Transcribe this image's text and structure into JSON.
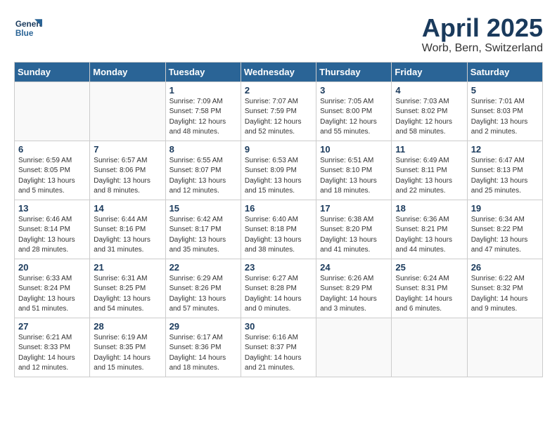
{
  "header": {
    "logo_line1": "General",
    "logo_line2": "Blue",
    "month": "April 2025",
    "location": "Worb, Bern, Switzerland"
  },
  "weekdays": [
    "Sunday",
    "Monday",
    "Tuesday",
    "Wednesday",
    "Thursday",
    "Friday",
    "Saturday"
  ],
  "weeks": [
    [
      {
        "day": "",
        "info": ""
      },
      {
        "day": "",
        "info": ""
      },
      {
        "day": "1",
        "info": "Sunrise: 7:09 AM\nSunset: 7:58 PM\nDaylight: 12 hours\nand 48 minutes."
      },
      {
        "day": "2",
        "info": "Sunrise: 7:07 AM\nSunset: 7:59 PM\nDaylight: 12 hours\nand 52 minutes."
      },
      {
        "day": "3",
        "info": "Sunrise: 7:05 AM\nSunset: 8:00 PM\nDaylight: 12 hours\nand 55 minutes."
      },
      {
        "day": "4",
        "info": "Sunrise: 7:03 AM\nSunset: 8:02 PM\nDaylight: 12 hours\nand 58 minutes."
      },
      {
        "day": "5",
        "info": "Sunrise: 7:01 AM\nSunset: 8:03 PM\nDaylight: 13 hours\nand 2 minutes."
      }
    ],
    [
      {
        "day": "6",
        "info": "Sunrise: 6:59 AM\nSunset: 8:05 PM\nDaylight: 13 hours\nand 5 minutes."
      },
      {
        "day": "7",
        "info": "Sunrise: 6:57 AM\nSunset: 8:06 PM\nDaylight: 13 hours\nand 8 minutes."
      },
      {
        "day": "8",
        "info": "Sunrise: 6:55 AM\nSunset: 8:07 PM\nDaylight: 13 hours\nand 12 minutes."
      },
      {
        "day": "9",
        "info": "Sunrise: 6:53 AM\nSunset: 8:09 PM\nDaylight: 13 hours\nand 15 minutes."
      },
      {
        "day": "10",
        "info": "Sunrise: 6:51 AM\nSunset: 8:10 PM\nDaylight: 13 hours\nand 18 minutes."
      },
      {
        "day": "11",
        "info": "Sunrise: 6:49 AM\nSunset: 8:11 PM\nDaylight: 13 hours\nand 22 minutes."
      },
      {
        "day": "12",
        "info": "Sunrise: 6:47 AM\nSunset: 8:13 PM\nDaylight: 13 hours\nand 25 minutes."
      }
    ],
    [
      {
        "day": "13",
        "info": "Sunrise: 6:46 AM\nSunset: 8:14 PM\nDaylight: 13 hours\nand 28 minutes."
      },
      {
        "day": "14",
        "info": "Sunrise: 6:44 AM\nSunset: 8:16 PM\nDaylight: 13 hours\nand 31 minutes."
      },
      {
        "day": "15",
        "info": "Sunrise: 6:42 AM\nSunset: 8:17 PM\nDaylight: 13 hours\nand 35 minutes."
      },
      {
        "day": "16",
        "info": "Sunrise: 6:40 AM\nSunset: 8:18 PM\nDaylight: 13 hours\nand 38 minutes."
      },
      {
        "day": "17",
        "info": "Sunrise: 6:38 AM\nSunset: 8:20 PM\nDaylight: 13 hours\nand 41 minutes."
      },
      {
        "day": "18",
        "info": "Sunrise: 6:36 AM\nSunset: 8:21 PM\nDaylight: 13 hours\nand 44 minutes."
      },
      {
        "day": "19",
        "info": "Sunrise: 6:34 AM\nSunset: 8:22 PM\nDaylight: 13 hours\nand 47 minutes."
      }
    ],
    [
      {
        "day": "20",
        "info": "Sunrise: 6:33 AM\nSunset: 8:24 PM\nDaylight: 13 hours\nand 51 minutes."
      },
      {
        "day": "21",
        "info": "Sunrise: 6:31 AM\nSunset: 8:25 PM\nDaylight: 13 hours\nand 54 minutes."
      },
      {
        "day": "22",
        "info": "Sunrise: 6:29 AM\nSunset: 8:26 PM\nDaylight: 13 hours\nand 57 minutes."
      },
      {
        "day": "23",
        "info": "Sunrise: 6:27 AM\nSunset: 8:28 PM\nDaylight: 14 hours\nand 0 minutes."
      },
      {
        "day": "24",
        "info": "Sunrise: 6:26 AM\nSunset: 8:29 PM\nDaylight: 14 hours\nand 3 minutes."
      },
      {
        "day": "25",
        "info": "Sunrise: 6:24 AM\nSunset: 8:31 PM\nDaylight: 14 hours\nand 6 minutes."
      },
      {
        "day": "26",
        "info": "Sunrise: 6:22 AM\nSunset: 8:32 PM\nDaylight: 14 hours\nand 9 minutes."
      }
    ],
    [
      {
        "day": "27",
        "info": "Sunrise: 6:21 AM\nSunset: 8:33 PM\nDaylight: 14 hours\nand 12 minutes."
      },
      {
        "day": "28",
        "info": "Sunrise: 6:19 AM\nSunset: 8:35 PM\nDaylight: 14 hours\nand 15 minutes."
      },
      {
        "day": "29",
        "info": "Sunrise: 6:17 AM\nSunset: 8:36 PM\nDaylight: 14 hours\nand 18 minutes."
      },
      {
        "day": "30",
        "info": "Sunrise: 6:16 AM\nSunset: 8:37 PM\nDaylight: 14 hours\nand 21 minutes."
      },
      {
        "day": "",
        "info": ""
      },
      {
        "day": "",
        "info": ""
      },
      {
        "day": "",
        "info": ""
      }
    ]
  ]
}
